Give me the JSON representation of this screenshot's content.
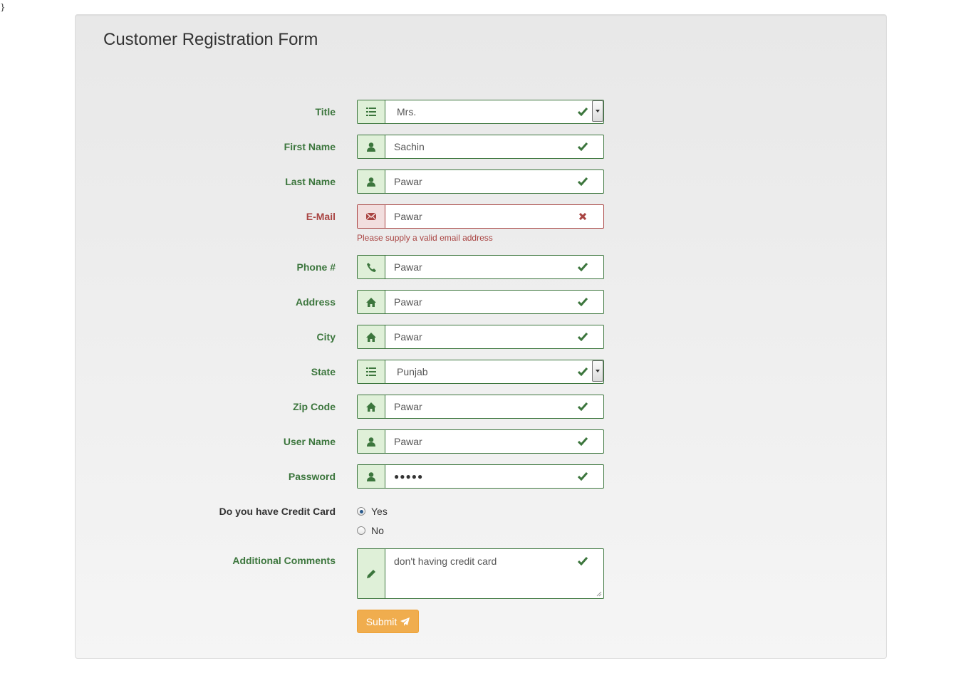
{
  "stray_text": "}",
  "form": {
    "legend": "Customer Registration Form",
    "fields": [
      {
        "label": "Title",
        "value": "Mrs.",
        "icon": "list-icon",
        "type": "select",
        "status": "success"
      },
      {
        "label": "First Name",
        "value": "Sachin",
        "icon": "user-icon",
        "type": "text",
        "status": "success"
      },
      {
        "label": "Last Name",
        "value": "Pawar",
        "icon": "user-icon",
        "type": "text",
        "status": "success"
      },
      {
        "label": "E-Mail",
        "value": "Pawar",
        "icon": "envelope-icon",
        "type": "email",
        "status": "error",
        "help": "Please supply a valid email address"
      },
      {
        "label": "Phone #",
        "value": "Pawar",
        "icon": "phone-icon",
        "type": "text",
        "status": "success"
      },
      {
        "label": "Address",
        "value": "Pawar",
        "icon": "home-icon",
        "type": "text",
        "status": "success"
      },
      {
        "label": "City",
        "value": "Pawar",
        "icon": "home-icon",
        "type": "text",
        "status": "success"
      },
      {
        "label": "State",
        "value": "Punjab",
        "icon": "list-icon",
        "type": "select",
        "status": "success"
      },
      {
        "label": "Zip Code",
        "value": "Pawar",
        "icon": "home-icon",
        "type": "text",
        "status": "success"
      },
      {
        "label": "User Name",
        "value": "Pawar",
        "icon": "user-icon",
        "type": "text",
        "status": "success"
      },
      {
        "label": "Password",
        "value": "●●●●●",
        "icon": "user-icon",
        "type": "password",
        "status": "success"
      }
    ],
    "credit_card": {
      "label": "Do you have Credit Card",
      "options": [
        {
          "label": "Yes",
          "checked": true
        },
        {
          "label": "No",
          "checked": false
        }
      ]
    },
    "comments": {
      "label": "Additional Comments",
      "value": "don't having credit card",
      "icon": "pencil-icon",
      "status": "success"
    },
    "submit_label": "Submit"
  },
  "colors": {
    "success": "#3c763d",
    "success_bg": "#dff0d8",
    "error": "#a94442",
    "error_bg": "#f2dede",
    "warning_button": "#f0ad4e"
  }
}
